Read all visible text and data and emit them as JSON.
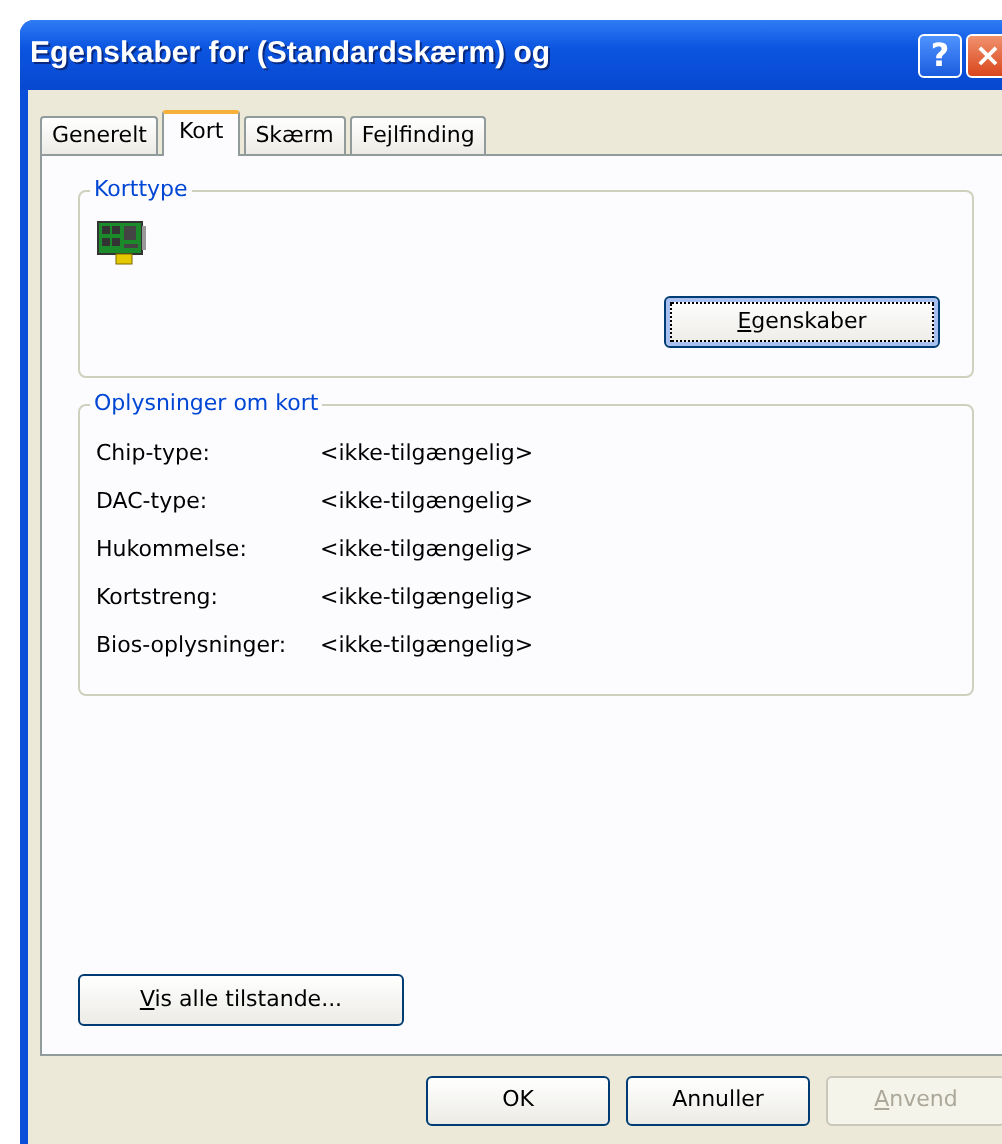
{
  "window": {
    "title": "Egenskaber for (Standardskærm) og",
    "help_glyph": "?",
    "close_glyph": "×"
  },
  "tabs": [
    {
      "label": "Generelt",
      "selected": false
    },
    {
      "label": "Kort",
      "selected": true
    },
    {
      "label": "Skærm",
      "selected": false
    },
    {
      "label": "Fejlfinding",
      "selected": false
    }
  ],
  "adapter_type": {
    "legend": "Korttype",
    "button": {
      "label": "Egenskaber",
      "underline_first": true,
      "disabled": false,
      "focused": true
    }
  },
  "adapter_info": {
    "legend": "Oplysninger om kort",
    "rows": [
      {
        "label": "Chip-type:",
        "value": "<ikke-tilgængelig>"
      },
      {
        "label": "DAC-type:",
        "value": "<ikke-tilgængelig>"
      },
      {
        "label": "Hukommelse:",
        "value": "<ikke-tilgængelig>"
      },
      {
        "label": "Kortstreng:",
        "value": "<ikke-tilgængelig>"
      },
      {
        "label": "Bios-oplysninger:",
        "value": "<ikke-tilgængelig>"
      }
    ]
  },
  "list_modes_button": {
    "label": "Vis alle tilstande...",
    "underline_first": true,
    "disabled": false,
    "focused": false
  },
  "buttons": [
    {
      "label": "OK",
      "underline_first": false,
      "disabled": false,
      "focused": false
    },
    {
      "label": "Annuller",
      "underline_first": false,
      "disabled": false,
      "focused": false
    },
    {
      "label": "Anvend",
      "underline_first": true,
      "disabled": true,
      "focused": false
    }
  ]
}
